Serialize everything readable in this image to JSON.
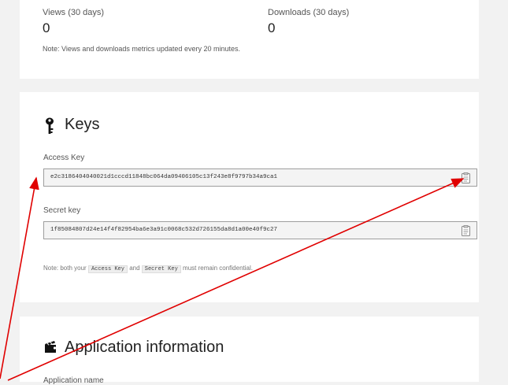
{
  "stats": {
    "views_label": "Views (30 days)",
    "views_value": "0",
    "downloads_label": "Downloads (30 days)",
    "downloads_value": "0",
    "note": "Note: Views and downloads metrics updated every 20 minutes."
  },
  "keys": {
    "title": "Keys",
    "access_label": "Access Key",
    "access_value": "e2c3186404040021d1cccd11848bc064da09406105c13f243e8f9797b34a9ca1",
    "secret_label": "Secret key",
    "secret_value": "1f85084807d24e14f4f82954ba6e3a91c0068c532d726155da8d1a00e40f9c27",
    "note_prefix": "Note: both your",
    "note_code_access": "Access Key",
    "note_and": "and",
    "note_code_secret": "Secret Key",
    "note_suffix": "must remain confidential."
  },
  "app": {
    "title": "Application information",
    "field_label": "Application name"
  },
  "annotations": {
    "arrow_color": "#e00000"
  }
}
